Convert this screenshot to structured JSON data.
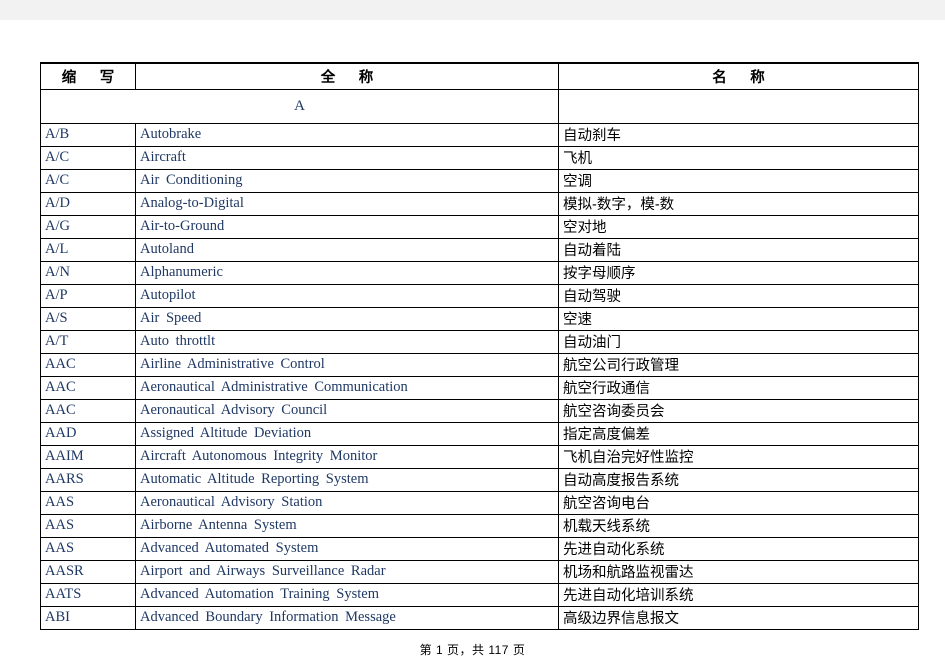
{
  "document": {
    "type": "glossary-table",
    "columns": [
      "缩  写",
      "全  称",
      "名  称"
    ],
    "section_letter": "A"
  },
  "table": {
    "headers": {
      "abbreviation": "缩  写",
      "full_name": "全  称",
      "chinese_name": "名  称"
    },
    "section_row": {
      "letter": "A"
    },
    "rows": [
      {
        "abbr": "A/B",
        "full": "Autobrake",
        "name": "自动刹车"
      },
      {
        "abbr": "A/C",
        "full": "Aircraft",
        "name": "飞机"
      },
      {
        "abbr": "A/C",
        "full": "Air  Conditioning",
        "name": "空调"
      },
      {
        "abbr": "A/D",
        "full": "Analog-to-Digital",
        "name": "模拟-数字，模-数"
      },
      {
        "abbr": "A/G",
        "full": "Air-to-Ground",
        "name": "空对地"
      },
      {
        "abbr": "A/L",
        "full": "Autoland",
        "name": "自动着陆"
      },
      {
        "abbr": "A/N",
        "full": "Alphanumeric",
        "name": "按字母顺序"
      },
      {
        "abbr": "A/P",
        "full": "Autopilot",
        "name": "自动驾驶"
      },
      {
        "abbr": "A/S",
        "full": "Air  Speed",
        "name": "空速"
      },
      {
        "abbr": "A/T",
        "full": "Auto  throttlt",
        "name": "自动油门"
      },
      {
        "abbr": "AAC",
        "full": "Airline  Administrative  Control",
        "name": "航空公司行政管理"
      },
      {
        "abbr": "AAC",
        "full": "Aeronautical  Administrative  Communication",
        "name": "航空行政通信"
      },
      {
        "abbr": "AAC",
        "full": "Aeronautical  Advisory  Council",
        "name": "航空咨询委员会"
      },
      {
        "abbr": "AAD",
        "full": "Assigned  Altitude  Deviation",
        "name": "指定高度偏差"
      },
      {
        "abbr": "AAIM",
        "full": "Aircraft  Autonomous  Integrity  Monitor",
        "name": "飞机自治完好性监控"
      },
      {
        "abbr": "AARS",
        "full": "Automatic  Altitude  Reporting  System",
        "name": "自动高度报告系统"
      },
      {
        "abbr": "AAS",
        "full": "Aeronautical  Advisory  Station",
        "name": "航空咨询电台"
      },
      {
        "abbr": "AAS",
        "full": "Airborne  Antenna  System",
        "name": "机载天线系统"
      },
      {
        "abbr": "AAS",
        "full": "Advanced  Automated  System",
        "name": "先进自动化系统"
      },
      {
        "abbr": "AASR",
        "full": "Airport  and  Airways  Surveillance  Radar",
        "name": "机场和航路监视雷达"
      },
      {
        "abbr": "AATS",
        "full": "Advanced  Automation  Training  System",
        "name": "先进自动化培训系统"
      },
      {
        "abbr": "ABI",
        "full": "Advanced  Boundary  Information  Message",
        "name": "高级边界信息报文"
      }
    ]
  },
  "footer": {
    "page_text": "第 1 页，共 117 页",
    "current_page": 1,
    "total_pages": 117
  },
  "colors": {
    "page_background": "#ffffff",
    "top_strip": "#f2f2f2",
    "border": "#000000",
    "english_text": "#1f3864",
    "chinese_text": "#000000",
    "section_letter": "#17365d"
  }
}
